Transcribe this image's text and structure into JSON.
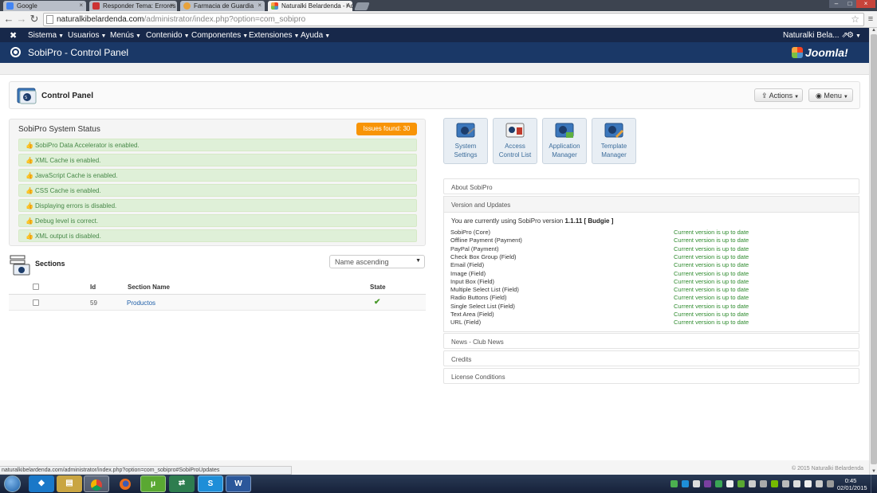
{
  "browser": {
    "tabs": [
      {
        "label": "Google",
        "active": false
      },
      {
        "label": "Responder Tema: Errores",
        "active": false
      },
      {
        "label": "Farmacia de Guardia",
        "active": false
      },
      {
        "label": "Naturalki Belardenda - Ad",
        "active": true
      }
    ],
    "url_host": "naturalkibelardenda.com",
    "url_path": "/administrator/index.php?option=com_sobipro",
    "status_url": "naturalkibelardenda.com/administrator/index.php?option=com_sobipro#SobiProUpdates"
  },
  "topmenu": {
    "items": [
      "Sistema",
      "Usuarios",
      "Menús",
      "Contenido",
      "Componentes",
      "Extensiones",
      "Ayuda"
    ],
    "user": "Naturalki Bela...",
    "brand": "Joomla!"
  },
  "header": {
    "title": "SobiPro - Control Panel"
  },
  "cpanel": {
    "title": "Control Panel",
    "actions_label": "Actions",
    "menu_label": "Menu"
  },
  "system_status": {
    "title": "SobiPro System Status",
    "issues_label": "Issues found: 30",
    "items": [
      "SobiPro Data Accelerator is enabled.",
      "XML Cache is enabled.",
      "JavaScript Cache is enabled.",
      "CSS Cache is enabled.",
      "Displaying errors is disabled.",
      "Debug level is correct.",
      "XML output is disabled."
    ]
  },
  "sections": {
    "title": "Sections",
    "sort_value": "Name ascending",
    "columns": {
      "id": "Id",
      "name": "Section Name",
      "state": "State"
    },
    "rows": [
      {
        "id": "59",
        "name": "Productos",
        "state": "✔"
      }
    ]
  },
  "quick_icons": [
    {
      "line1": "System",
      "line2": "Settings"
    },
    {
      "line1": "Access",
      "line2": "Control List"
    },
    {
      "line1": "Application",
      "line2": "Manager"
    },
    {
      "line1": "Template",
      "line2": "Manager"
    }
  ],
  "accordion": {
    "about": "About SobiPro",
    "version_title": "Version and Updates",
    "version_prefix": "You are currently using SobiPro version",
    "version_value": "1.1.11 [ Budgie ]",
    "status_text": "Current version is up to date",
    "extensions": [
      "SobiPro (Core)",
      "Offline Payment (Payment)",
      "PayPal (Payment)",
      "Check Box Group (Field)",
      "Email (Field)",
      "Image (Field)",
      "Input Box (Field)",
      "Multiple Select List (Field)",
      "Radio Buttons (Field)",
      "Single Select List (Field)",
      "Text Area (Field)",
      "URL (Field)"
    ],
    "news": "News - Club News",
    "credits": "Credits",
    "license": "License Conditions"
  },
  "footer": {
    "copyright": "© 2015 Naturalki Belardenda"
  },
  "taskbar": {
    "clock_time": "0:45",
    "clock_date": "02/01/2015"
  },
  "colors": {
    "navy": "#17284a",
    "header_blue": "#1a3867",
    "success_green": "#468847",
    "warning_orange": "#f89406",
    "link_blue": "#1f5fa8"
  }
}
